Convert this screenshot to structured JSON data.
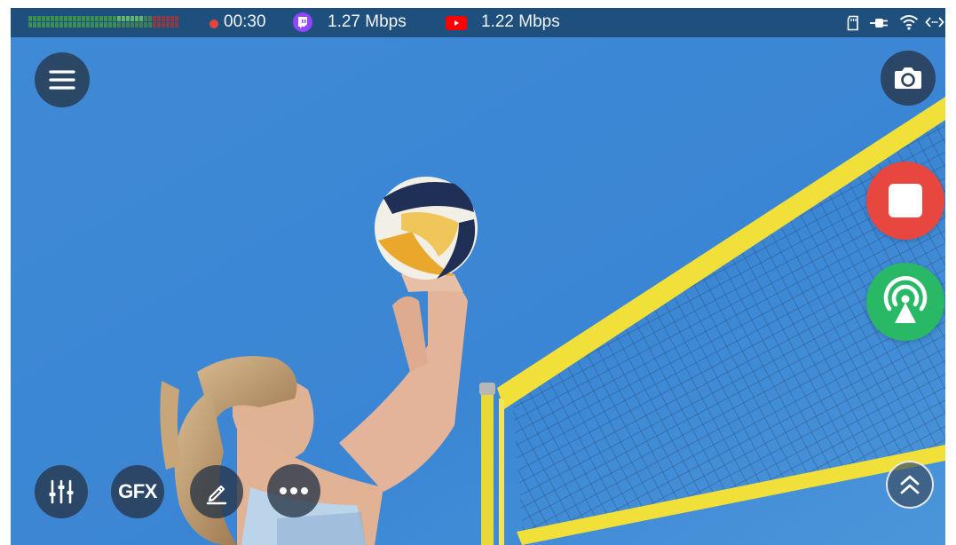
{
  "status_bar": {
    "timer": "00:30",
    "twitch_bitrate": "1.27 Mbps",
    "youtube_bitrate": "1.22 Mbps",
    "colors": {
      "background": "#1f4f7d",
      "record_dot": "#e2453c",
      "twitch": "#9146ff",
      "youtube": "#ff0000",
      "audio_green": "#4caf50"
    },
    "icons": [
      "record-dot-icon",
      "twitch-icon",
      "youtube-icon",
      "sd-card-icon",
      "power-plug-icon",
      "wifi-icon",
      "remote-code-icon"
    ]
  },
  "left_controls": {
    "menu_icon": "hamburger-menu-icon",
    "mixer_icon": "audio-mixer-icon",
    "gfx_label": "GFX",
    "draw_icon": "pencil-icon",
    "more_icon": "more-dots-icon"
  },
  "right_controls": {
    "camera_icon": "camera-icon",
    "stop_icon": "stop-record-icon",
    "broadcast_icon": "broadcast-antenna-icon",
    "expand_icon": "chevron-double-up-icon",
    "colors": {
      "stop": "#e8473f",
      "broadcast": "#29b865"
    }
  }
}
